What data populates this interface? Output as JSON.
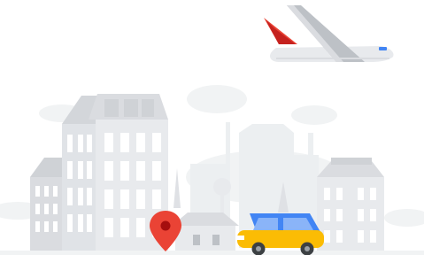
{
  "illustration": {
    "icons": {
      "airplane": "airplane-icon",
      "location_pin": "location-pin-icon",
      "car": "car-icon"
    },
    "colors": {
      "background": "#ffffff",
      "building_light": "#e8eaed",
      "building_mid": "#dadce0",
      "building_dark": "#bdc1c6",
      "window": "#ffffff",
      "haze": "#f1f3f4",
      "plane_body": "#e8eaed",
      "plane_tail_red": "#ea4335",
      "plane_window_blue": "#4285f4",
      "pin_red": "#ea4335",
      "car_yellow": "#fbbc04",
      "car_roof_blue": "#4285f4",
      "tire": "#3c4043"
    }
  }
}
